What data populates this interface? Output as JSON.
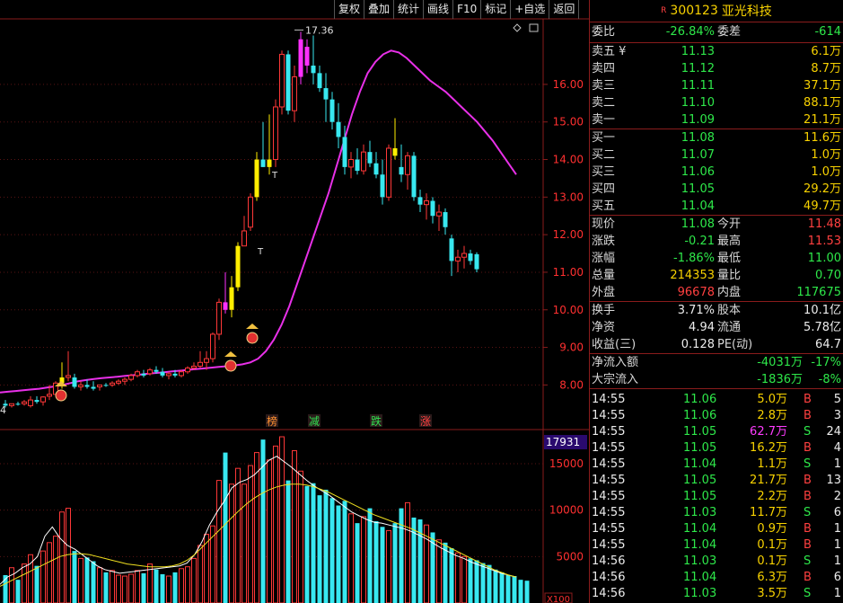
{
  "toolbar": {
    "buttons": [
      "复权",
      "叠加",
      "统计",
      "画线",
      "F10",
      "标记",
      "+自选",
      "返回"
    ]
  },
  "stock": {
    "badge": "R",
    "code": "300123",
    "name": "亚光科技"
  },
  "summary": {
    "webi_label": "委比",
    "webi_value": "-26.84%",
    "weicha_label": "委差",
    "weicha_value": "-614"
  },
  "order_book": {
    "asks": [
      {
        "label": "卖五 ¥",
        "price": "11.13",
        "volume": "6.1万"
      },
      {
        "label": "卖四",
        "price": "11.12",
        "volume": "8.7万"
      },
      {
        "label": "卖三",
        "price": "11.11",
        "volume": "37.1万"
      },
      {
        "label": "卖二",
        "price": "11.10",
        "volume": "88.1万"
      },
      {
        "label": "卖一",
        "price": "11.09",
        "volume": "21.1万"
      }
    ],
    "bids": [
      {
        "label": "买一",
        "price": "11.08",
        "volume": "11.6万"
      },
      {
        "label": "买二",
        "price": "11.07",
        "volume": "1.0万"
      },
      {
        "label": "买三",
        "price": "11.06",
        "volume": "1.0万"
      },
      {
        "label": "买四",
        "price": "11.05",
        "volume": "29.2万"
      },
      {
        "label": "买五",
        "price": "11.04",
        "volume": "49.7万"
      }
    ]
  },
  "stats": {
    "block1": [
      {
        "l1": "现价",
        "v1": "11.08",
        "c1": "green",
        "l2": "今开",
        "v2": "11.48",
        "c2": "red"
      },
      {
        "l1": "涨跌",
        "v1": "-0.21",
        "c1": "green",
        "l2": "最高",
        "v2": "11.53",
        "c2": "red"
      },
      {
        "l1": "涨幅",
        "v1": "-1.86%",
        "c1": "green",
        "l2": "最低",
        "v2": "11.00",
        "c2": "green"
      },
      {
        "l1": "总量",
        "v1": "214353",
        "c1": "yellow",
        "l2": "量比",
        "v2": "0.70",
        "c2": "green"
      },
      {
        "l1": "外盘",
        "v1": "96678",
        "c1": "red",
        "l2": "内盘",
        "v2": "117675",
        "c2": "green"
      }
    ],
    "block2": [
      {
        "l1": "换手",
        "v1": "3.71%",
        "c1": "white",
        "l2": "股本",
        "v2": "10.1亿",
        "c2": "white"
      },
      {
        "l1": "净资",
        "v1": "4.94",
        "c1": "white",
        "l2": "流通",
        "v2": "5.78亿",
        "c2": "white"
      },
      {
        "l1": "收益(三)",
        "v1": "0.128",
        "c1": "white",
        "l2": "PE(动)",
        "v2": "64.7",
        "c2": "white"
      }
    ]
  },
  "flows": [
    {
      "label": "净流入额",
      "value": "-4031万",
      "pct": "-17%"
    },
    {
      "label": "大宗流入",
      "value": "-1836万",
      "pct": "-8%"
    }
  ],
  "ticks": [
    {
      "time": "14:55",
      "price": "11.06",
      "vol": "5.0万",
      "side": "B",
      "count": "5"
    },
    {
      "time": "14:55",
      "price": "11.06",
      "vol": "2.8万",
      "side": "B",
      "count": "3"
    },
    {
      "time": "14:55",
      "price": "11.05",
      "vol": "62.7万",
      "side": "S",
      "count": "24",
      "big": true
    },
    {
      "time": "14:55",
      "price": "11.05",
      "vol": "16.2万",
      "side": "B",
      "count": "4"
    },
    {
      "time": "14:55",
      "price": "11.04",
      "vol": "1.1万",
      "side": "S",
      "count": "1"
    },
    {
      "time": "14:55",
      "price": "11.05",
      "vol": "21.7万",
      "side": "B",
      "count": "13"
    },
    {
      "time": "14:55",
      "price": "11.05",
      "vol": "2.2万",
      "side": "B",
      "count": "2"
    },
    {
      "time": "14:55",
      "price": "11.03",
      "vol": "11.7万",
      "side": "S",
      "count": "6"
    },
    {
      "time": "14:55",
      "price": "11.04",
      "vol": "0.9万",
      "side": "B",
      "count": "1"
    },
    {
      "time": "14:55",
      "price": "11.04",
      "vol": "0.1万",
      "side": "B",
      "count": "1"
    },
    {
      "time": "14:56",
      "price": "11.03",
      "vol": "0.1万",
      "side": "S",
      "count": "1"
    },
    {
      "time": "14:56",
      "price": "11.04",
      "vol": "6.3万",
      "side": "B",
      "count": "6"
    },
    {
      "time": "14:56",
      "price": "11.03",
      "vol": "3.5万",
      "side": "S",
      "count": "1"
    }
  ],
  "chart_data": {
    "type": "candlestick",
    "price_axis_ticks": [
      "16.00",
      "15.00",
      "14.00",
      "13.00",
      "12.00",
      "11.00",
      "10.00",
      "9.00",
      "8.00"
    ],
    "price_ylim": [
      7.1,
      17.6
    ],
    "high_marker": "17.36",
    "left_label": "4",
    "event_labels": [
      "榜",
      "减",
      "跌",
      "涨"
    ],
    "candles": [
      {
        "o": 7.5,
        "h": 7.6,
        "l": 7.4,
        "c": 7.45
      },
      {
        "o": 7.45,
        "h": 7.5,
        "l": 7.4,
        "c": 7.5
      },
      {
        "o": 7.5,
        "h": 7.55,
        "l": 7.45,
        "c": 7.48
      },
      {
        "o": 7.5,
        "h": 7.6,
        "l": 7.45,
        "c": 7.55
      },
      {
        "o": 7.45,
        "h": 7.7,
        "l": 7.4,
        "c": 7.6
      },
      {
        "o": 7.6,
        "h": 7.7,
        "l": 7.5,
        "c": 7.55
      },
      {
        "o": 7.55,
        "h": 7.7,
        "l": 7.45,
        "c": 7.68
      },
      {
        "o": 7.7,
        "h": 8.0,
        "l": 7.6,
        "c": 7.75
      },
      {
        "o": 7.75,
        "h": 8.1,
        "l": 7.7,
        "c": 8.05
      },
      {
        "o": 8.05,
        "h": 8.6,
        "l": 7.9,
        "c": 8.2
      },
      {
        "o": 8.2,
        "h": 8.9,
        "l": 8.1,
        "c": 8.25
      },
      {
        "o": 8.2,
        "h": 8.3,
        "l": 7.9,
        "c": 7.95
      },
      {
        "o": 7.95,
        "h": 8.1,
        "l": 7.85,
        "c": 8.0
      },
      {
        "o": 8.0,
        "h": 8.15,
        "l": 7.9,
        "c": 7.95
      },
      {
        "o": 7.95,
        "h": 8.1,
        "l": 7.85,
        "c": 7.9
      },
      {
        "o": 7.95,
        "h": 8.0,
        "l": 7.85,
        "c": 8.0
      },
      {
        "o": 8.0,
        "h": 8.05,
        "l": 7.95,
        "c": 7.98
      },
      {
        "o": 8.0,
        "h": 8.1,
        "l": 7.95,
        "c": 8.05
      },
      {
        "o": 8.05,
        "h": 8.15,
        "l": 8.0,
        "c": 8.1
      },
      {
        "o": 8.1,
        "h": 8.2,
        "l": 8.0,
        "c": 8.15
      },
      {
        "o": 8.15,
        "h": 8.3,
        "l": 8.1,
        "c": 8.25
      },
      {
        "o": 8.25,
        "h": 8.4,
        "l": 8.2,
        "c": 8.35
      },
      {
        "o": 8.3,
        "h": 8.4,
        "l": 8.2,
        "c": 8.25
      },
      {
        "o": 8.3,
        "h": 8.45,
        "l": 8.25,
        "c": 8.4
      },
      {
        "o": 8.4,
        "h": 8.5,
        "l": 8.3,
        "c": 8.35
      },
      {
        "o": 8.35,
        "h": 8.45,
        "l": 8.2,
        "c": 8.25
      },
      {
        "o": 8.25,
        "h": 8.35,
        "l": 8.15,
        "c": 8.3
      },
      {
        "o": 8.3,
        "h": 8.4,
        "l": 8.2,
        "c": 8.25
      },
      {
        "o": 8.25,
        "h": 8.4,
        "l": 8.2,
        "c": 8.35
      },
      {
        "o": 8.35,
        "h": 8.5,
        "l": 8.3,
        "c": 8.45
      },
      {
        "o": 8.45,
        "h": 8.6,
        "l": 8.4,
        "c": 8.5
      },
      {
        "o": 8.5,
        "h": 8.9,
        "l": 8.45,
        "c": 8.6
      },
      {
        "o": 8.6,
        "h": 8.9,
        "l": 8.4,
        "c": 8.7
      },
      {
        "o": 8.7,
        "h": 9.4,
        "l": 8.6,
        "c": 9.35
      },
      {
        "o": 9.35,
        "h": 10.3,
        "l": 9.2,
        "c": 10.2
      },
      {
        "o": 10.2,
        "h": 11.0,
        "l": 9.9,
        "c": 10.0
      },
      {
        "o": 10.0,
        "h": 10.9,
        "l": 9.8,
        "c": 10.6
      },
      {
        "o": 10.6,
        "h": 11.8,
        "l": 10.5,
        "c": 11.7
      },
      {
        "o": 11.7,
        "h": 12.5,
        "l": 11.7,
        "c": 12.1
      },
      {
        "o": 12.2,
        "h": 13.1,
        "l": 12.1,
        "c": 13.0
      },
      {
        "o": 13.0,
        "h": 14.2,
        "l": 12.9,
        "c": 14.0
      },
      {
        "o": 14.0,
        "h": 15.0,
        "l": 13.8,
        "c": 13.8
      },
      {
        "o": 13.8,
        "h": 15.2,
        "l": 13.6,
        "c": 14.0
      },
      {
        "o": 14.0,
        "h": 15.6,
        "l": 13.8,
        "c": 15.4
      },
      {
        "o": 15.4,
        "h": 16.9,
        "l": 15.2,
        "c": 16.8
      },
      {
        "o": 16.8,
        "h": 16.9,
        "l": 15.2,
        "c": 15.3
      },
      {
        "o": 15.3,
        "h": 16.5,
        "l": 15.0,
        "c": 16.2
      },
      {
        "o": 16.2,
        "h": 17.4,
        "l": 16.0,
        "c": 17.2
      },
      {
        "o": 17.0,
        "h": 17.2,
        "l": 16.3,
        "c": 16.5
      },
      {
        "o": 16.5,
        "h": 17.3,
        "l": 16.0,
        "c": 16.3
      },
      {
        "o": 16.3,
        "h": 16.5,
        "l": 15.8,
        "c": 15.9
      },
      {
        "o": 15.9,
        "h": 16.3,
        "l": 15.0,
        "c": 15.6
      },
      {
        "o": 15.6,
        "h": 15.8,
        "l": 14.8,
        "c": 15.0
      },
      {
        "o": 15.0,
        "h": 15.5,
        "l": 14.3,
        "c": 14.6
      },
      {
        "o": 14.6,
        "h": 14.9,
        "l": 13.6,
        "c": 13.8
      },
      {
        "o": 13.8,
        "h": 14.2,
        "l": 13.5,
        "c": 14.0
      },
      {
        "o": 14.0,
        "h": 14.3,
        "l": 13.6,
        "c": 13.7
      },
      {
        "o": 13.7,
        "h": 14.4,
        "l": 13.6,
        "c": 14.2
      },
      {
        "o": 14.2,
        "h": 14.5,
        "l": 13.8,
        "c": 13.9
      },
      {
        "o": 13.9,
        "h": 14.2,
        "l": 13.5,
        "c": 13.6
      },
      {
        "o": 13.6,
        "h": 14.0,
        "l": 12.8,
        "c": 13.0
      },
      {
        "o": 13.0,
        "h": 14.4,
        "l": 12.9,
        "c": 14.3
      },
      {
        "o": 14.3,
        "h": 15.1,
        "l": 14.0,
        "c": 14.1
      },
      {
        "o": 13.8,
        "h": 14.4,
        "l": 13.4,
        "c": 13.6
      },
      {
        "o": 13.6,
        "h": 14.2,
        "l": 13.2,
        "c": 14.1
      },
      {
        "o": 14.1,
        "h": 14.2,
        "l": 12.9,
        "c": 13.0
      },
      {
        "o": 13.0,
        "h": 13.2,
        "l": 12.6,
        "c": 12.8
      },
      {
        "o": 12.8,
        "h": 13.1,
        "l": 12.4,
        "c": 12.9
      },
      {
        "o": 12.9,
        "h": 13.0,
        "l": 12.3,
        "c": 12.5
      },
      {
        "o": 12.5,
        "h": 12.8,
        "l": 12.1,
        "c": 12.6
      },
      {
        "o": 12.6,
        "h": 12.7,
        "l": 12.0,
        "c": 12.2
      },
      {
        "o": 11.9,
        "h": 12.0,
        "l": 10.9,
        "c": 11.3
      },
      {
        "o": 11.3,
        "h": 11.6,
        "l": 11.0,
        "c": 11.4
      },
      {
        "o": 11.4,
        "h": 11.7,
        "l": 11.1,
        "c": 11.5
      },
      {
        "o": 11.5,
        "h": 11.6,
        "l": 11.2,
        "c": 11.3
      },
      {
        "o": 11.48,
        "h": 11.53,
        "l": 11.0,
        "c": 11.08
      }
    ],
    "ma_line": [
      7.8,
      7.82,
      7.84,
      7.86,
      7.88,
      7.9,
      7.93,
      7.96,
      8.0,
      8.05,
      8.1,
      8.13,
      8.16,
      8.18,
      8.2,
      8.22,
      8.24,
      8.26,
      8.28,
      8.3,
      8.32,
      8.34,
      8.36,
      8.38,
      8.4,
      8.42,
      8.44,
      8.46,
      8.48,
      8.5,
      8.52,
      8.55,
      8.6,
      8.7,
      8.9,
      9.2,
      9.6,
      10.1,
      10.7,
      11.3,
      11.9,
      12.5,
      13.1,
      13.8,
      14.5,
      15.2,
      15.8,
      16.3,
      16.6,
      16.8,
      16.9,
      16.85,
      16.7,
      16.5,
      16.3,
      16.1,
      15.95,
      15.8,
      15.6,
      15.4,
      15.2,
      15.0,
      14.75,
      14.5,
      14.2,
      13.9,
      13.6
    ],
    "volume_axis_ticks": [
      "15000",
      "10000",
      "5000"
    ],
    "volume_ylim": [
      0,
      18000
    ],
    "volume_readout": "17931",
    "volume_unit": "X100",
    "volumes": [
      3000,
      3800,
      2500,
      4200,
      5200,
      4000,
      5600,
      6500,
      7200,
      9800,
      10200,
      5600,
      4800,
      4900,
      4500,
      3800,
      3300,
      3500,
      3000,
      2900,
      3100,
      3500,
      3200,
      4200,
      3600,
      3100,
      2900,
      3300,
      3700,
      3900,
      4800,
      6200,
      7400,
      8300,
      13200,
      16200,
      12800,
      14500,
      12800,
      14800,
      16200,
      17600,
      15400,
      16900,
      17900,
      13200,
      16400,
      14200,
      12600,
      12900,
      11600,
      12200,
      11300,
      10500,
      11000,
      9600,
      8600,
      9300,
      10200,
      8800,
      8200,
      7800,
      8600,
      10200,
      10800,
      9200,
      9000,
      8400,
      7600,
      6800,
      6500,
      5900,
      5400,
      5000,
      4800,
      4600,
      4300,
      4100,
      3600,
      3300,
      3000,
      2900,
      2500,
      2400
    ],
    "vol_ma5": [
      2000,
      2800,
      3200,
      3800,
      4200,
      5000,
      7200,
      8200,
      7000,
      6200,
      5800,
      5200,
      4600,
      4000,
      3600,
      3400,
      3200,
      3300,
      3400,
      3500,
      3600,
      3700,
      3800,
      3900,
      4000,
      4300,
      5200,
      6600,
      8400,
      9800,
      11000,
      12400,
      13000,
      13300,
      13800,
      14600,
      15400,
      15800,
      15200,
      14600,
      13900,
      13200,
      12600,
      12100,
      11600,
      11000,
      10400,
      9800,
      9400,
      9000,
      8700,
      8600,
      8400,
      8200,
      8000,
      7700,
      7300,
      6900,
      6400,
      5900,
      5500,
      5100,
      4800,
      4400,
      4100,
      3800,
      3500,
      3200,
      3000,
      2800
    ],
    "vol_ma10": [
      1800,
      2200,
      2600,
      3000,
      3400,
      3800,
      4200,
      4600,
      5000,
      5200,
      5300,
      5300,
      5200,
      5000,
      4800,
      4600,
      4400,
      4200,
      4100,
      4000,
      3900,
      3900,
      3900,
      4000,
      4200,
      4600,
      5200,
      6000,
      6800,
      7600,
      8400,
      9200,
      10000,
      10700,
      11300,
      11800,
      12200,
      12500,
      12700,
      12800,
      12800,
      12700,
      12500,
      12200,
      11900,
      11500,
      11100,
      10700,
      10300,
      9900,
      9500,
      9200,
      8900,
      8600,
      8300,
      8000,
      7600,
      7200,
      6800,
      6400,
      6000,
      5600,
      5200,
      4800,
      4400,
      4000,
      3600,
      3300,
      3000,
      2800
    ]
  }
}
